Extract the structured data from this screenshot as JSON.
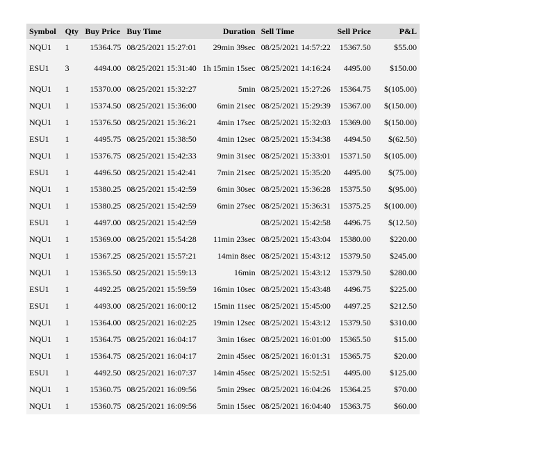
{
  "table": {
    "headers": [
      "Symbol",
      "Qty",
      "Buy Price",
      "Buy Time",
      "Duration",
      "Sell Time",
      "Sell Price",
      "P&L"
    ],
    "rows": [
      [
        "NQU1",
        "1",
        "15364.75",
        "08/25/2021 15:27:01",
        "29min 39sec",
        "08/25/2021 14:57:22",
        "15367.50",
        "$55.00"
      ],
      [
        "ESU1",
        "3",
        "4494.00",
        "08/25/2021 15:31:40",
        "1h 15min 15sec",
        "08/25/2021 14:16:24",
        "4495.00",
        "$150.00"
      ],
      [
        "NQU1",
        "1",
        "15370.00",
        "08/25/2021 15:32:27",
        "5min",
        "08/25/2021 15:27:26",
        "15364.75",
        "$(105.00)"
      ],
      [
        "NQU1",
        "1",
        "15374.50",
        "08/25/2021 15:36:00",
        "6min 21sec",
        "08/25/2021 15:29:39",
        "15367.00",
        "$(150.00)"
      ],
      [
        "NQU1",
        "1",
        "15376.50",
        "08/25/2021 15:36:21",
        "4min 17sec",
        "08/25/2021 15:32:03",
        "15369.00",
        "$(150.00)"
      ],
      [
        "ESU1",
        "1",
        "4495.75",
        "08/25/2021 15:38:50",
        "4min 12sec",
        "08/25/2021 15:34:38",
        "4494.50",
        "$(62.50)"
      ],
      [
        "NQU1",
        "1",
        "15376.75",
        "08/25/2021 15:42:33",
        "9min 31sec",
        "08/25/2021 15:33:01",
        "15371.50",
        "$(105.00)"
      ],
      [
        "ESU1",
        "1",
        "4496.50",
        "08/25/2021 15:42:41",
        "7min 21sec",
        "08/25/2021 15:35:20",
        "4495.00",
        "$(75.00)"
      ],
      [
        "NQU1",
        "1",
        "15380.25",
        "08/25/2021 15:42:59",
        "6min 30sec",
        "08/25/2021 15:36:28",
        "15375.50",
        "$(95.00)"
      ],
      [
        "NQU1",
        "1",
        "15380.25",
        "08/25/2021 15:42:59",
        "6min 27sec",
        "08/25/2021 15:36:31",
        "15375.25",
        "$(100.00)"
      ],
      [
        "ESU1",
        "1",
        "4497.00",
        "08/25/2021 15:42:59",
        "",
        "08/25/2021 15:42:58",
        "4496.75",
        "$(12.50)"
      ],
      [
        "NQU1",
        "1",
        "15369.00",
        "08/25/2021 15:54:28",
        "11min 23sec",
        "08/25/2021 15:43:04",
        "15380.00",
        "$220.00"
      ],
      [
        "NQU1",
        "1",
        "15367.25",
        "08/25/2021 15:57:21",
        "14min 8sec",
        "08/25/2021 15:43:12",
        "15379.50",
        "$245.00"
      ],
      [
        "NQU1",
        "1",
        "15365.50",
        "08/25/2021 15:59:13",
        "16min",
        "08/25/2021 15:43:12",
        "15379.50",
        "$280.00"
      ],
      [
        "ESU1",
        "1",
        "4492.25",
        "08/25/2021 15:59:59",
        "16min 10sec",
        "08/25/2021 15:43:48",
        "4496.75",
        "$225.00"
      ],
      [
        "ESU1",
        "1",
        "4493.00",
        "08/25/2021 16:00:12",
        "15min 11sec",
        "08/25/2021 15:45:00",
        "4497.25",
        "$212.50"
      ],
      [
        "NQU1",
        "1",
        "15364.00",
        "08/25/2021 16:02:25",
        "19min 12sec",
        "08/25/2021 15:43:12",
        "15379.50",
        "$310.00"
      ],
      [
        "NQU1",
        "1",
        "15364.75",
        "08/25/2021 16:04:17",
        "3min 16sec",
        "08/25/2021 16:01:00",
        "15365.50",
        "$15.00"
      ],
      [
        "NQU1",
        "1",
        "15364.75",
        "08/25/2021 16:04:17",
        "2min 45sec",
        "08/25/2021 16:01:31",
        "15365.75",
        "$20.00"
      ],
      [
        "ESU1",
        "1",
        "4492.50",
        "08/25/2021 16:07:37",
        "14min 45sec",
        "08/25/2021 15:52:51",
        "4495.00",
        "$125.00"
      ],
      [
        "NQU1",
        "1",
        "15360.75",
        "08/25/2021 16:09:56",
        "5min 29sec",
        "08/25/2021 16:04:26",
        "15364.25",
        "$70.00"
      ],
      [
        "NQU1",
        "1",
        "15360.75",
        "08/25/2021 16:09:56",
        "5min 15sec",
        "08/25/2021 16:04:40",
        "15363.75",
        "$60.00"
      ]
    ]
  }
}
